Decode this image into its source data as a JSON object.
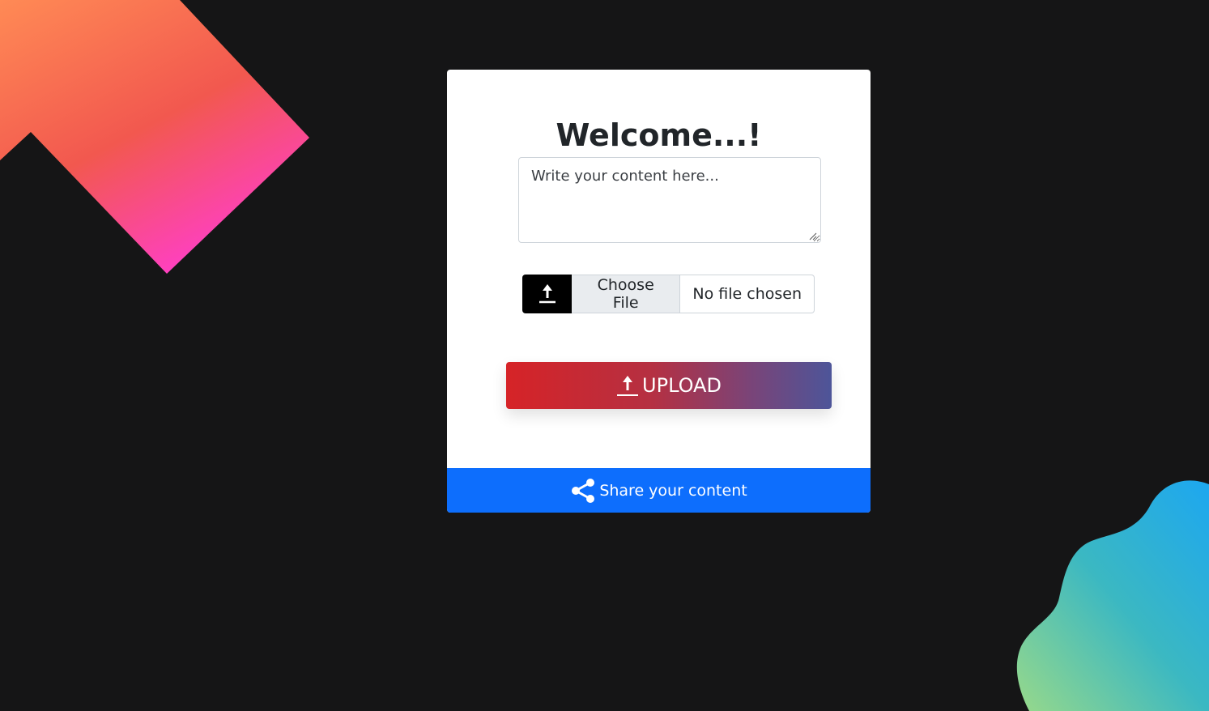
{
  "card": {
    "title": "Welcome...!"
  },
  "content_input": {
    "placeholder": "Write your content here..."
  },
  "file_picker": {
    "icon": "upload-icon",
    "choose_label": "Choose File",
    "status": "No file chosen"
  },
  "upload_button": {
    "icon": "upload-icon",
    "label": "UPLOAD"
  },
  "share_bar": {
    "icon": "share-icon",
    "label": "Share your content"
  },
  "colors": {
    "background": "#151516",
    "card": "#ffffff",
    "share_bar": "#0d6efd",
    "upload_gradient_start": "#d62327",
    "upload_gradient_end": "#4d5599",
    "file_icon_box": "#000000"
  }
}
